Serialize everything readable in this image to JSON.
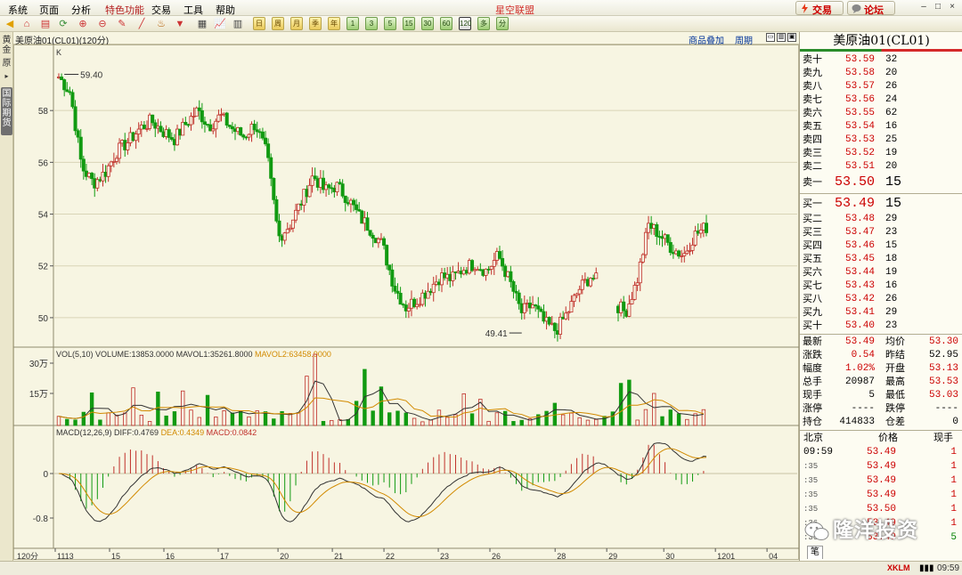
{
  "menu": {
    "items": [
      "系统",
      "页面",
      "分析",
      "特色功能",
      "交易",
      "工具",
      "帮助"
    ],
    "app_title": "星空联盟",
    "trade_button": "交易",
    "forum_button": "论坛"
  },
  "toolbar": {
    "periods": [
      "日",
      "周",
      "月",
      "季",
      "年",
      "1",
      "3",
      "5",
      "15",
      "30",
      "60",
      "120",
      "多",
      "分"
    ],
    "selected_period": "120"
  },
  "left_strip": {
    "tabs": [
      "黄金",
      "原",
      "国际期货"
    ]
  },
  "chart_header": {
    "title": "美原油01(CL01)(120分)",
    "overlay_link": "商品叠加",
    "cycle_link": "周期"
  },
  "chart_data": [
    {
      "type": "candlestick",
      "title": "美原油01(CL01)(120分)",
      "series_label": "K",
      "ylim": [
        49,
        60
      ],
      "y_ticks": [
        50,
        52,
        54,
        56,
        58
      ],
      "x_tick_labels": [
        "1113",
        "15",
        "16",
        "17",
        "20",
        "21",
        "22",
        "23",
        "26",
        "28",
        "29",
        "30",
        "1201",
        "04"
      ],
      "x_axis_unit": "120分",
      "annotations": [
        {
          "label": "59.40",
          "value": 59.4
        },
        {
          "label": "49.41",
          "value": 49.41
        }
      ],
      "path_points": [
        59.3,
        58.7,
        55.8,
        55.2,
        55.6,
        56.4,
        56.8,
        57.3,
        57.6,
        57.2,
        56.9,
        57.5,
        58.0,
        57.4,
        57.8,
        57.3,
        57.0,
        57.5,
        56.3,
        53.1,
        53.6,
        54.5,
        55.5,
        54.9,
        55.1,
        54.6,
        53.9,
        53.4,
        52.8,
        51.2,
        50.4,
        50.7,
        51.1,
        51.6,
        51.5,
        51.9,
        52.1,
        51.8,
        52.4,
        51.4,
        50.2,
        50.5,
        49.8,
        49.5,
        50.2,
        51.1,
        51.6,
        51.3,
        50.6,
        50.2,
        51.4,
        53.6,
        53.2,
        52.7,
        52.4,
        53.2,
        53.5
      ]
    },
    {
      "type": "bar",
      "title": "VOL(5,10)",
      "volume": "13853.0000",
      "mavol1": "35261.8000",
      "mavol2": "63458.9000",
      "y_ticks": [
        "30万",
        "15万"
      ]
    },
    {
      "type": "line",
      "title": "MACD(12,26,9)",
      "diff": "0.4769",
      "dea": "0.4349",
      "macd": "0.0842",
      "y_ticks": [
        "0",
        "-0.8"
      ]
    }
  ],
  "right_panel": {
    "title": "美原油01(CL01)",
    "asks": [
      {
        "label": "卖十",
        "price": "53.59",
        "vol": "32"
      },
      {
        "label": "卖九",
        "price": "53.58",
        "vol": "20"
      },
      {
        "label": "卖八",
        "price": "53.57",
        "vol": "26"
      },
      {
        "label": "卖七",
        "price": "53.56",
        "vol": "24"
      },
      {
        "label": "卖六",
        "price": "53.55",
        "vol": "62"
      },
      {
        "label": "卖五",
        "price": "53.54",
        "vol": "16"
      },
      {
        "label": "卖四",
        "price": "53.53",
        "vol": "25"
      },
      {
        "label": "卖三",
        "price": "53.52",
        "vol": "19"
      },
      {
        "label": "卖二",
        "price": "53.51",
        "vol": "20"
      },
      {
        "label": "卖一",
        "price": "53.50",
        "vol": "15"
      }
    ],
    "bids": [
      {
        "label": "买一",
        "price": "53.49",
        "vol": "15"
      },
      {
        "label": "买二",
        "price": "53.48",
        "vol": "29"
      },
      {
        "label": "买三",
        "price": "53.47",
        "vol": "23"
      },
      {
        "label": "买四",
        "price": "53.46",
        "vol": "15"
      },
      {
        "label": "买五",
        "price": "53.45",
        "vol": "18"
      },
      {
        "label": "买六",
        "price": "53.44",
        "vol": "19"
      },
      {
        "label": "买七",
        "price": "53.43",
        "vol": "16"
      },
      {
        "label": "买八",
        "price": "53.42",
        "vol": "26"
      },
      {
        "label": "买九",
        "price": "53.41",
        "vol": "29"
      },
      {
        "label": "买十",
        "price": "53.40",
        "vol": "23"
      }
    ],
    "stats": [
      {
        "k1": "最新",
        "v1": "53.49",
        "k2": "均价",
        "v2": "53.30"
      },
      {
        "k1": "涨跌",
        "v1": "0.54",
        "k2": "昨结",
        "v2": "52.95"
      },
      {
        "k1": "幅度",
        "v1": "1.02%",
        "k2": "开盘",
        "v2": "53.13"
      },
      {
        "k1": "总手",
        "v1": "20987",
        "k2": "最高",
        "v2": "53.53"
      },
      {
        "k1": "现手",
        "v1": "5",
        "k2": "最低",
        "v2": "53.03"
      },
      {
        "k1": "涨停",
        "v1": "----",
        "k2": "跌停",
        "v2": "----"
      },
      {
        "k1": "持仓",
        "v1": "414833",
        "k2": "仓差",
        "v2": "0"
      }
    ],
    "ticks_header": {
      "region": "北京",
      "price": "价格",
      "vol": "现手"
    },
    "ticks": [
      {
        "time": "09:59",
        "price": "53.49",
        "vol": "1"
      },
      {
        "time": ":35",
        "price": "53.49",
        "vol": "1"
      },
      {
        "time": ":35",
        "price": "53.49",
        "vol": "1"
      },
      {
        "time": ":35",
        "price": "53.49",
        "vol": "1"
      },
      {
        "time": ":35",
        "price": "53.50",
        "vol": "1"
      },
      {
        "time": ":36",
        "price": "53.49",
        "vol": "1"
      },
      {
        "time": ":36",
        "price": "53.49",
        "vol": "5"
      }
    ],
    "tab": "笔",
    "watermark": "隆洋投资"
  },
  "status": {
    "brand": "XKLM",
    "clock": "09:59"
  }
}
